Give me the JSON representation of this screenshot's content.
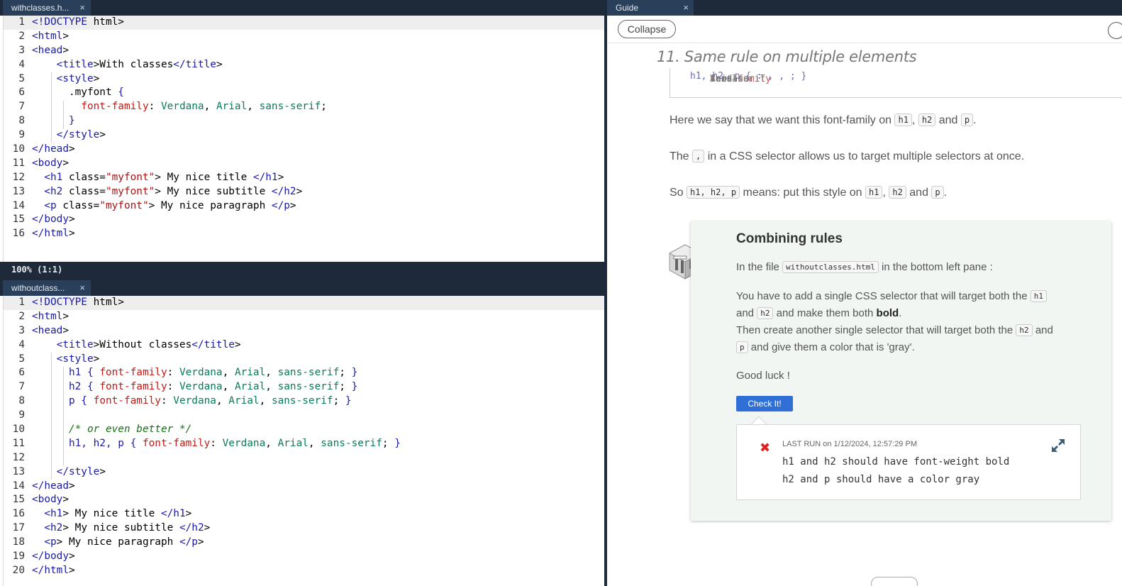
{
  "top_pane": {
    "tab_label": "withclasses.h...",
    "close_glyph": "×",
    "lines": [
      {
        "n": "1",
        "html": "<span class='tg'>&lt;!DOCTYPE</span> html&gt;"
      },
      {
        "n": "2",
        "html": "<span class='tg'>&lt;html</span>&gt;"
      },
      {
        "n": "3",
        "html": "<span class='tg'>&lt;head</span>&gt;"
      },
      {
        "n": "4",
        "html": "    <span class='tg'>&lt;title</span>&gt;With classes<span class='tg'>&lt;/title</span>&gt;"
      },
      {
        "n": "5",
        "html": "    <span class='tg'>&lt;style</span>&gt;"
      },
      {
        "n": "6",
        "html": "      .myfont <span class='kw'>{</span>"
      },
      {
        "n": "7",
        "html": "        <span class='pr'>font-family</span>: <span class='vl'>Verdana</span>, <span class='vl'>Arial</span>, <span class='vl'>sans-serif</span>;"
      },
      {
        "n": "8",
        "html": "      <span class='kw'>}</span>"
      },
      {
        "n": "9",
        "html": "    <span class='tg'>&lt;/style</span>&gt;"
      },
      {
        "n": "10",
        "html": "<span class='tg'>&lt;/head</span>&gt;"
      },
      {
        "n": "11",
        "html": "<span class='tg'>&lt;body</span>&gt;"
      },
      {
        "n": "12",
        "html": "  <span class='tg'>&lt;h1</span> class=<span class='st'>\"myfont\"</span>&gt; My nice title <span class='tg'>&lt;/h1</span>&gt;"
      },
      {
        "n": "13",
        "html": "  <span class='tg'>&lt;h2</span> class=<span class='st'>\"myfont\"</span>&gt; My nice subtitle <span class='tg'>&lt;/h2</span>&gt;"
      },
      {
        "n": "14",
        "html": "  <span class='tg'>&lt;p</span> class=<span class='st'>\"myfont\"</span>&gt; My nice paragraph <span class='tg'>&lt;/p</span>&gt;"
      },
      {
        "n": "15",
        "html": "<span class='tg'>&lt;/body</span>&gt;"
      },
      {
        "n": "16",
        "html": "<span class='tg'>&lt;/html</span>&gt;"
      }
    ],
    "status": "100%  (1:1)"
  },
  "bottom_pane": {
    "tab_label": "withoutclass...",
    "close_glyph": "×",
    "lines": [
      {
        "n": "1",
        "html": "<span class='tg'>&lt;!DOCTYPE</span> html&gt;"
      },
      {
        "n": "2",
        "html": "<span class='tg'>&lt;html</span>&gt;"
      },
      {
        "n": "3",
        "html": "<span class='tg'>&lt;head</span>&gt;"
      },
      {
        "n": "4",
        "html": "    <span class='tg'>&lt;title</span>&gt;Without classes<span class='tg'>&lt;/title</span>&gt;"
      },
      {
        "n": "5",
        "html": "    <span class='tg'>&lt;style</span>&gt;"
      },
      {
        "n": "6",
        "html": "      <span class='kw'>h1 {</span> <span class='pr'>font-family</span>: <span class='vl'>Verdana</span>, <span class='vl'>Arial</span>, <span class='vl'>sans-serif</span>; <span class='kw'>}</span>"
      },
      {
        "n": "7",
        "html": "      <span class='kw'>h2 {</span> <span class='pr'>font-family</span>: <span class='vl'>Verdana</span>, <span class='vl'>Arial</span>, <span class='vl'>sans-serif</span>; <span class='kw'>}</span>"
      },
      {
        "n": "8",
        "html": "      <span class='kw'>p {</span> <span class='pr'>font-family</span>: <span class='vl'>Verdana</span>, <span class='vl'>Arial</span>, <span class='vl'>sans-serif</span>; <span class='kw'>}</span>"
      },
      {
        "n": "9",
        "html": ""
      },
      {
        "n": "10",
        "html": "      <span class='cm'>/* or even better */</span>"
      },
      {
        "n": "11",
        "html": "      <span class='kw'>h1, h2, p {</span> <span class='pr'>font-family</span>: <span class='vl'>Verdana</span>, <span class='vl'>Arial</span>, <span class='vl'>sans-serif</span>; <span class='kw'>}</span>"
      },
      {
        "n": "12",
        "html": ""
      },
      {
        "n": "13",
        "html": "    <span class='tg'>&lt;/style</span>&gt;"
      },
      {
        "n": "14",
        "html": "<span class='tg'>&lt;/head</span>&gt;"
      },
      {
        "n": "15",
        "html": "<span class='tg'>&lt;body</span>&gt;"
      },
      {
        "n": "16",
        "html": "  <span class='tg'>&lt;h1</span>&gt; My nice title <span class='tg'>&lt;/h1</span>&gt;"
      },
      {
        "n": "17",
        "html": "  <span class='tg'>&lt;h2</span>&gt; My nice subtitle <span class='tg'>&lt;/h2</span>&gt;"
      },
      {
        "n": "18",
        "html": "  <span class='tg'>&lt;p</span>&gt; My nice paragraph <span class='tg'>&lt;/p</span>&gt;"
      },
      {
        "n": "19",
        "html": "<span class='tg'>&lt;/body</span>&gt;"
      },
      {
        "n": "20",
        "html": "<span class='tg'>&lt;/html</span>&gt;"
      }
    ]
  },
  "guide": {
    "tab_label": "Guide",
    "close_glyph": "×",
    "collapse_label": "Collapse",
    "section_title": "11. Same rule on multiple elements",
    "snippet_html": "h1, h2, p { <span class='pr'>font-family</span>: <span class='vl'>Verdana</span>, <span class='vl'>Arial</span>, <span class='vl'>sans-serif</span>; }",
    "para1_html": "Here we say that we want this font-family on <span class='cc'>h1</span>, <span class='cc'>h2</span> and <span class='cc'>p</span>.",
    "para2_html": "The <span class='cc'>,</span> in a CSS selector allows us to target multiple selectors at once.",
    "para3_html": "So <span class='cc'>h1, h2, p</span> means: put this style on <span class='cc'>h1</span>, <span class='cc'>h2</span> and <span class='cc'>p</span>.",
    "task": {
      "icon": "exercise-icon",
      "title": "Combining rules",
      "p1_html": "In the file <span class='cc'>withoutclasses.html</span> in the bottom left pane :",
      "p2_html": "You have to add a single CSS selector that will target both the <span class='cc'>h1</span>",
      "p3_html": "and <span class='cc'>h2</span> and make them both <b>bold</b>.",
      "p4_html": "Then create another single selector that will target both the <span class='cc'>h2</span> and",
      "p5_html": "<span class='cc'>p</span> and give them a color that is 'gray'.",
      "p6": "Good luck !",
      "check_label": "Check It!",
      "result": {
        "fail_glyph": "✖",
        "last_run_label": "LAST RUN",
        "last_run_on": "on 1/12/2024, 12:57:29 PM",
        "messages": [
          "h1 and h2 should have font-weight bold",
          "h2 and p should have a color gray"
        ]
      }
    }
  }
}
